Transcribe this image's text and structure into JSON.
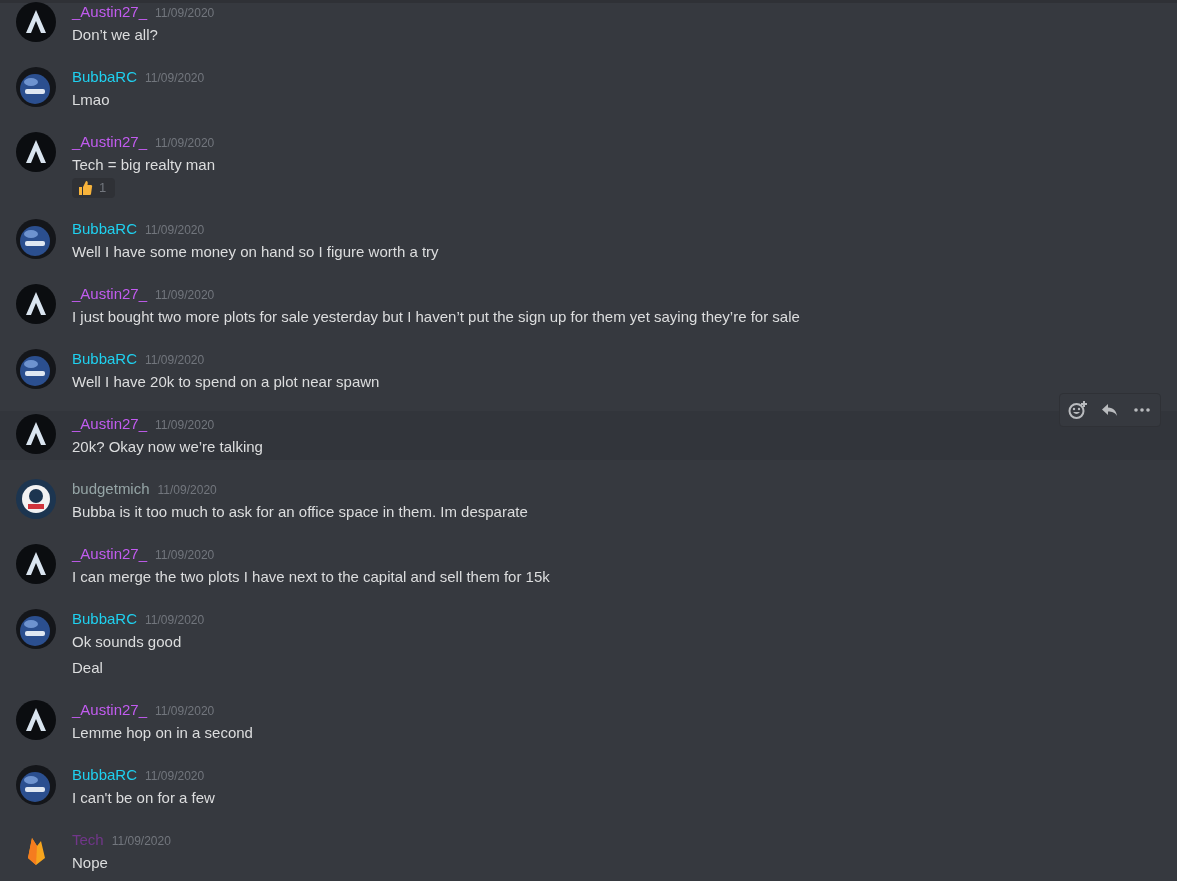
{
  "messages": [
    {
      "author": "_Austin27_",
      "color": "#c25cf0",
      "avatar": {
        "kind": "letter"
      },
      "timestamp": "11/09/2020",
      "lines": [
        "Don’t we all?"
      ],
      "hovered": false
    },
    {
      "author": "BubbaRC",
      "color": "#1fd1f0",
      "avatar": {
        "kind": "orb"
      },
      "timestamp": "11/09/2020",
      "lines": [
        "Lmao"
      ],
      "hovered": false
    },
    {
      "author": "_Austin27_",
      "color": "#c25cf0",
      "avatar": {
        "kind": "letter"
      },
      "timestamp": "11/09/2020",
      "lines": [
        "Tech = big realty man"
      ],
      "reactions": [
        {
          "count": "1"
        }
      ],
      "hovered": false
    },
    {
      "author": "BubbaRC",
      "color": "#1fd1f0",
      "avatar": {
        "kind": "orb"
      },
      "timestamp": "11/09/2020",
      "lines": [
        "Well I have some money on hand so I figure worth a try"
      ],
      "hovered": false
    },
    {
      "author": "_Austin27_",
      "color": "#c25cf0",
      "avatar": {
        "kind": "letter"
      },
      "timestamp": "11/09/2020",
      "lines": [
        "I just bought two more plots for sale yesterday but I haven’t put the sign up for them yet saying they’re for sale"
      ],
      "hovered": false
    },
    {
      "author": "BubbaRC",
      "color": "#1fd1f0",
      "avatar": {
        "kind": "orb"
      },
      "timestamp": "11/09/2020",
      "lines": [
        "Well I have 20k to spend on a plot near spawn"
      ],
      "hovered": false
    },
    {
      "author": "_Austin27_",
      "color": "#c25cf0",
      "avatar": {
        "kind": "letter"
      },
      "timestamp": "11/09/2020",
      "lines": [
        "20k? Okay now we’re talking"
      ],
      "hovered": true
    },
    {
      "author": "budgetmich",
      "color": "#95a5a6",
      "avatar": {
        "kind": "seal"
      },
      "timestamp": "11/09/2020",
      "lines": [
        "Bubba is it too much to ask for an office space in them. Im desparate"
      ],
      "hovered": false
    },
    {
      "author": "_Austin27_",
      "color": "#c25cf0",
      "avatar": {
        "kind": "letter"
      },
      "timestamp": "11/09/2020",
      "lines": [
        "I can merge the two plots I have next to the capital and sell them for 15k"
      ],
      "hovered": false
    },
    {
      "author": "BubbaRC",
      "color": "#1fd1f0",
      "avatar": {
        "kind": "orb"
      },
      "timestamp": "11/09/2020",
      "lines": [
        "Ok sounds good",
        "Deal"
      ],
      "hovered": false
    },
    {
      "author": "_Austin27_",
      "color": "#c25cf0",
      "avatar": {
        "kind": "letter"
      },
      "timestamp": "11/09/2020",
      "lines": [
        "Lemme hop on in a second"
      ],
      "hovered": false
    },
    {
      "author": "BubbaRC",
      "color": "#1fd1f0",
      "avatar": {
        "kind": "orb"
      },
      "timestamp": "11/09/2020",
      "lines": [
        "I can't be on for a few"
      ],
      "hovered": false
    },
    {
      "author": "Tech",
      "color": "#71368a",
      "avatar": {
        "kind": "flame"
      },
      "timestamp": "11/09/2020",
      "lines": [
        "Nope"
      ],
      "hovered": false
    }
  ]
}
